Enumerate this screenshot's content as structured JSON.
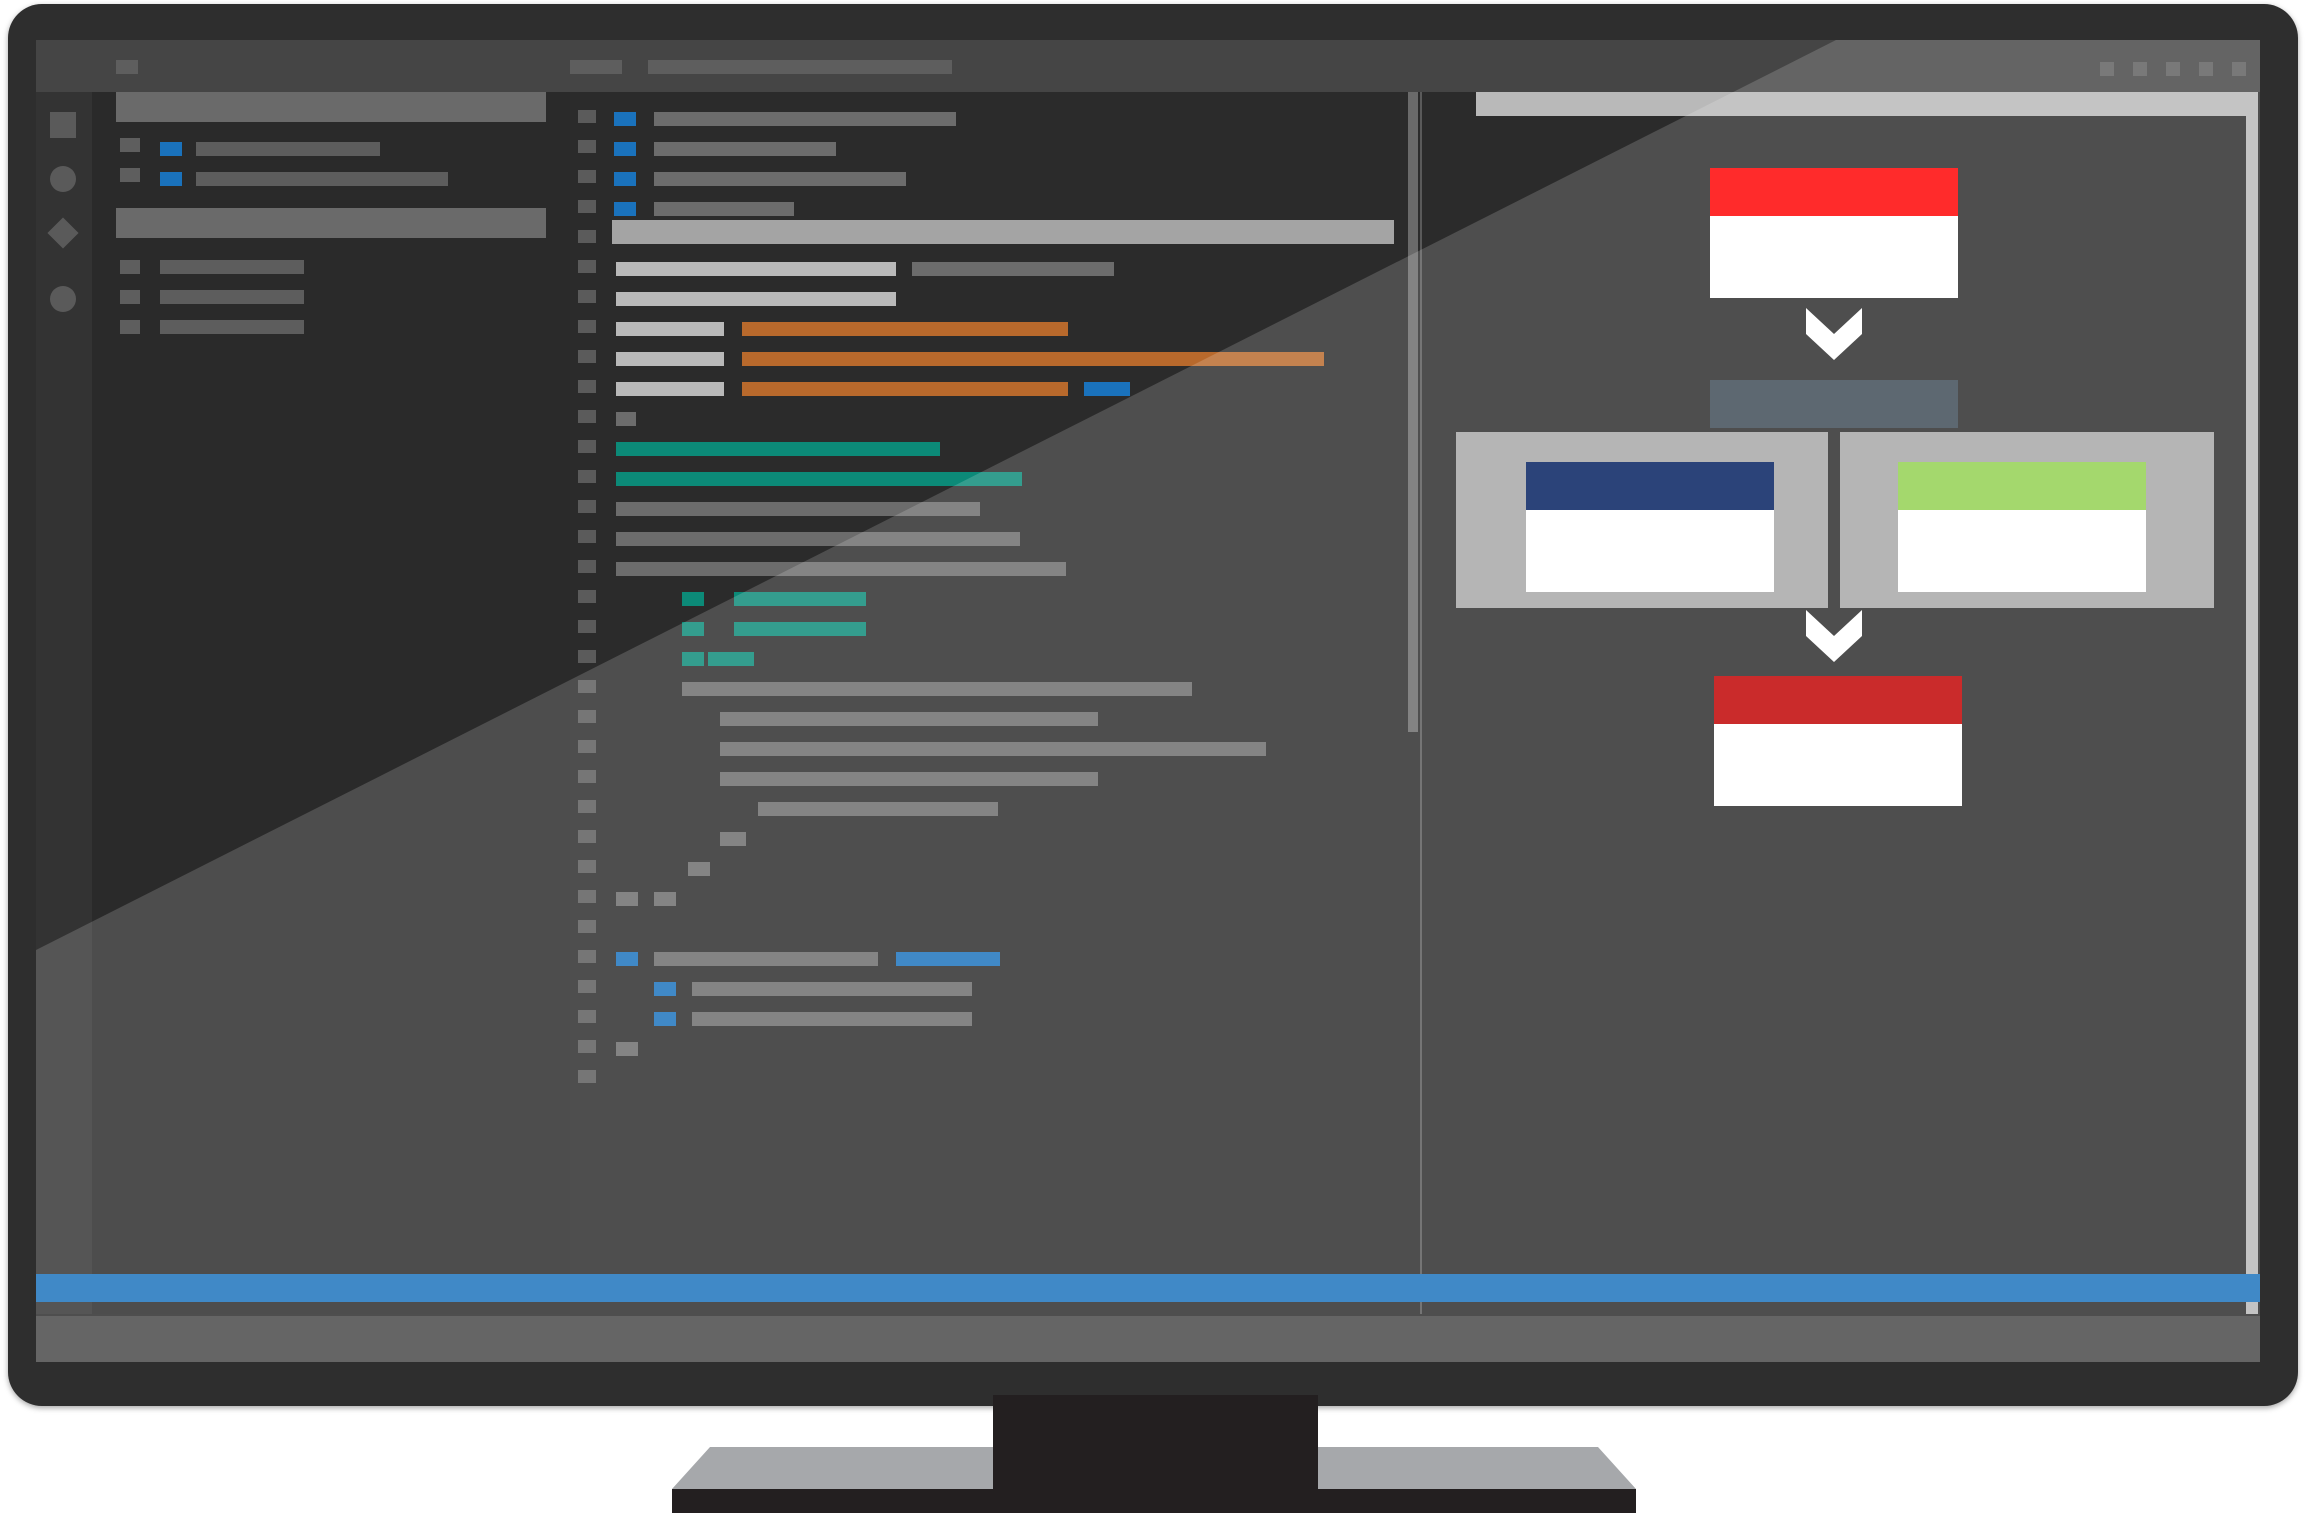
{
  "image": {
    "description_semantic": "monitor-illustration",
    "colors": {
      "bezel": "#2e2e2e",
      "screen_bg": "#2b2b2b",
      "accent_blue": "#1a72bc",
      "code_orange": "#b8692c",
      "code_teal": "#0c8a78",
      "flow_top_red": "#ff0000",
      "flow_branch_navy": "#001e5e",
      "flow_branch_green": "#92d050",
      "flow_bottom_red": "#c00000",
      "flow_middle_bar": "#3d4a55",
      "flow_container": "#a6a6a6",
      "stand": "#231f20",
      "stand_base": "#a6a8ab"
    },
    "icons": [
      "file-icon",
      "search-icon",
      "source-control-icon",
      "extensions-icon"
    ],
    "flowchart": {
      "nodes": [
        "top-card",
        "middle-bar",
        "left-branch-card",
        "right-branch-card",
        "bottom-card"
      ],
      "arrows": [
        "down-chevron-1",
        "down-chevron-2"
      ]
    }
  }
}
